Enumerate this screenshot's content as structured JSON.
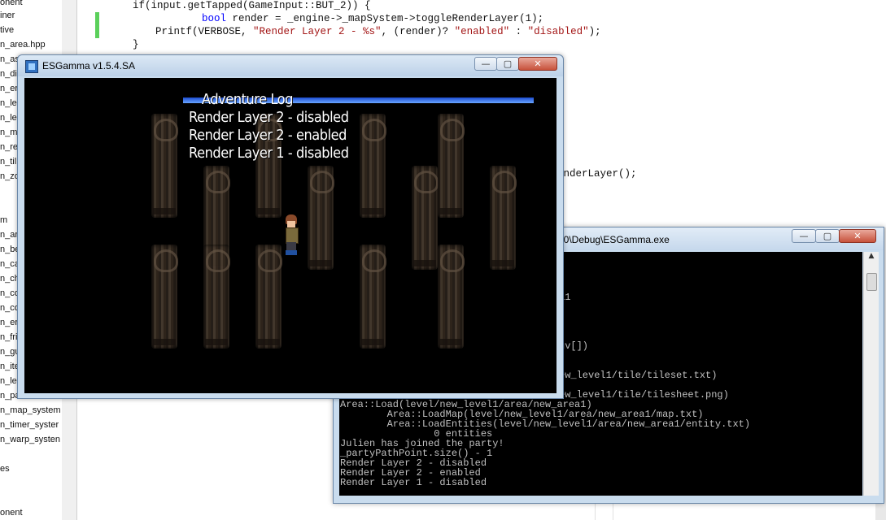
{
  "ide": {
    "sidebar_items": [
      "onent",
      "iner",
      "tive",
      "n_area.hpp",
      "n_as",
      "n_di",
      "n_er",
      "n_le",
      "n_le",
      "n_m",
      "n_re",
      "n_til",
      "n_zo",
      "m",
      "n_ar",
      "n_be",
      "n_ca",
      "n_ch",
      "n_co",
      "n_co",
      "n_er",
      "n_fri",
      "n_gu",
      "n_ite",
      "n_le",
      "n_pa",
      "n_map_system",
      "n_timer_syster",
      "n_warp_systen",
      "es",
      "onent"
    ],
    "code_line_1": "if(input.getTapped(GameInput::BUT_2)) {",
    "code_line_2_kw": "bool",
    "code_line_2": " render = _engine->_mapSystem->toggleRenderLayer(1);",
    "code_line_3_a": "Printf(VERBOSE, ",
    "code_line_3_str1": "\"Render Layer 2 - %s\"",
    "code_line_3_b": ", (render)? ",
    "code_line_3_str2": "\"enabled\"",
    "code_line_3_c": " : ",
    "code_line_3_str3": "\"disabled\"",
    "code_line_3_d": ");",
    "code_line_4": "}",
    "code_frag_1": ");",
    "code_frag_2": ");",
    "code_frag_3": "enderLayer();"
  },
  "game_window": {
    "title": "ESGamma v1.5.4.SA",
    "minimize": "—",
    "maximize": "▢",
    "close": "✕",
    "log_title": "Adventure Log",
    "log_lines": [
      "Render Layer 2 - disabled",
      "Render Layer 2 - enabled",
      "Render Layer 1 - disabled"
    ]
  },
  "console_window": {
    "title": "10\\Debug\\ESGamma.exe",
    "minimize": "—",
    "maximize": "▢",
    "close": "✕",
    "lines": [
      "a1",
      "gv[])",
      "ew_level1/tile/tileset.txt)",
      "ew_level1/tile/tilesheet.png)",
      "Area::Load(level/new_level1/area/new_area1)",
      "        Area::LoadMap(level/new_level1/area/new_area1/map.txt)",
      "        Area::LoadEntities(level/new_level1/area/new_area1/entity.txt)",
      "                0 entities",
      "Julien has joined the party!",
      "_partyPathPoint.size() - 1",
      "Render Layer 2 - disabled",
      "Render Layer 2 - enabled",
      "Render Layer 1 - disabled"
    ],
    "scroll_up": "▲"
  },
  "colors": {
    "log_bar": "#1c4bd1",
    "titlebar": "#c9dcee",
    "diff_marker": "#5bd05b"
  }
}
